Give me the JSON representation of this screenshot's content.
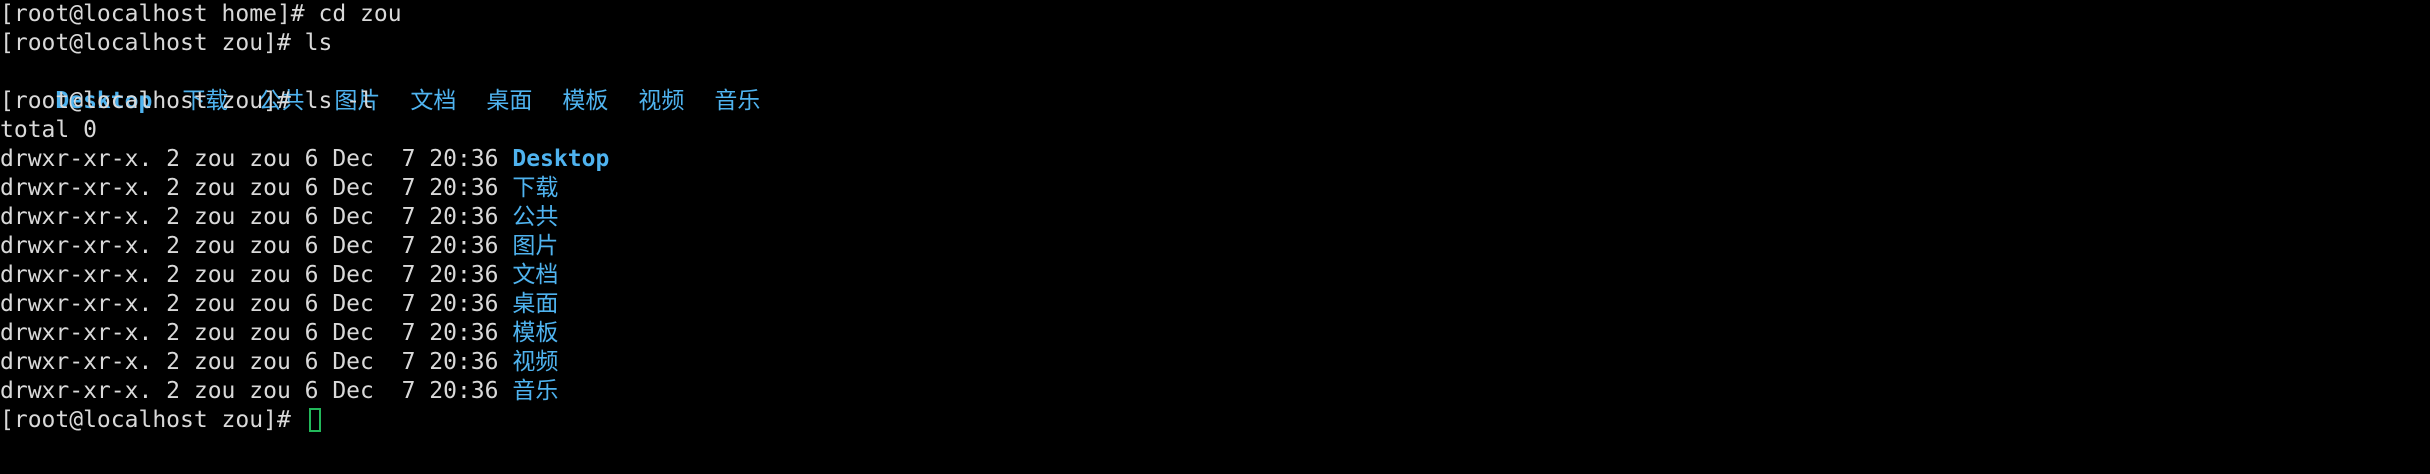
{
  "colors": {
    "background": "#000000",
    "text": "#d9d9d9",
    "directory": "#4fb3ef",
    "cursor": "#22b85a"
  },
  "lines": {
    "cd_cmd": "[root@localhost home]# cd zou",
    "ls_cmd": "[root@localhost zou]# ls",
    "ls_l_cmd": "[root@localhost zou]# ls -l",
    "total": "total 0",
    "prompt": "[root@localhost zou]# "
  },
  "ls_output": [
    "Desktop",
    "下载",
    "公共",
    "图片",
    "文档",
    "桌面",
    "模板",
    "视频",
    "音乐"
  ],
  "ls_l_rows": [
    {
      "perms": "drwxr-xr-x. 2 zou zou 6 Dec  7 20:36 ",
      "name": "Desktop"
    },
    {
      "perms": "drwxr-xr-x. 2 zou zou 6 Dec  7 20:36 ",
      "name": "下载"
    },
    {
      "perms": "drwxr-xr-x. 2 zou zou 6 Dec  7 20:36 ",
      "name": "公共"
    },
    {
      "perms": "drwxr-xr-x. 2 zou zou 6 Dec  7 20:36 ",
      "name": "图片"
    },
    {
      "perms": "drwxr-xr-x. 2 zou zou 6 Dec  7 20:36 ",
      "name": "文档"
    },
    {
      "perms": "drwxr-xr-x. 2 zou zou 6 Dec  7 20:36 ",
      "name": "桌面"
    },
    {
      "perms": "drwxr-xr-x. 2 zou zou 6 Dec  7 20:36 ",
      "name": "模板"
    },
    {
      "perms": "drwxr-xr-x. 2 zou zou 6 Dec  7 20:36 ",
      "name": "视频"
    },
    {
      "perms": "drwxr-xr-x. 2 zou zou 6 Dec  7 20:36 ",
      "name": "音乐"
    }
  ]
}
